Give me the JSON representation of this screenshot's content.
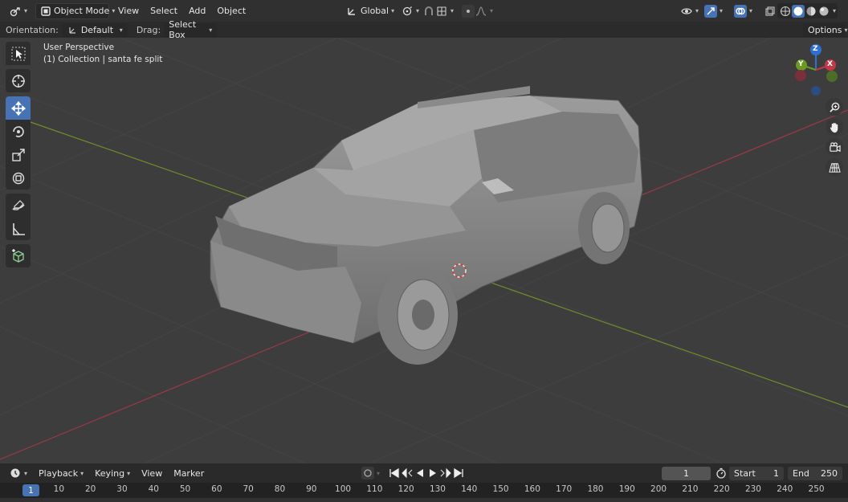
{
  "header": {
    "mode": "Object Mode",
    "menus": [
      "View",
      "Select",
      "Add",
      "Object"
    ],
    "transform_orientation": "Global",
    "icons": [
      "editor-type-icon",
      "object-mode-icon",
      "transform-pivot-icon",
      "snap-icon",
      "proportional-edit-icon",
      "visibility-icon",
      "gizmo-icon",
      "overlay-icon",
      "xray-icon",
      "shading-wireframe-icon",
      "shading-solid-icon",
      "shading-material-icon",
      "shading-rendered-icon"
    ]
  },
  "tool_settings": {
    "orientation_label": "Orientation:",
    "orientation_value": "Default",
    "drag_label": "Drag:",
    "drag_value": "Select Box",
    "options_label": "Options"
  },
  "viewport": {
    "view_name": "User Perspective",
    "collection_info": "(1) Collection | santa fe split",
    "gizmo_labels": {
      "z": "Z",
      "y": "Y",
      "x": "X"
    },
    "colors": {
      "background": "#3d3d3d",
      "x_axis": "#9a3a44",
      "y_axis": "#6c8f2a",
      "active_tool": "#4772b3"
    }
  },
  "tools": [
    "select-box",
    "cursor",
    "move",
    "rotate",
    "scale",
    "transform",
    "annotate",
    "measure",
    "add-cube"
  ],
  "timeline": {
    "menus": [
      "Playback",
      "Keying",
      "View",
      "Marker"
    ],
    "current_frame": "1",
    "start_label": "Start",
    "start_value": "1",
    "end_label": "End",
    "end_value": "250",
    "ruler_current": "1",
    "ruler_ticks": [
      "10",
      "20",
      "30",
      "40",
      "50",
      "60",
      "70",
      "80",
      "90",
      "100",
      "110",
      "120",
      "130",
      "140",
      "150",
      "160",
      "170",
      "180",
      "190",
      "200",
      "210",
      "220",
      "230",
      "240",
      "250"
    ]
  }
}
